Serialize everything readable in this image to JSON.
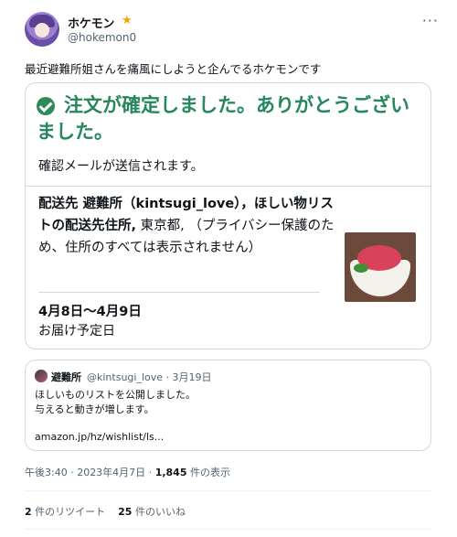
{
  "user": {
    "name": "ホケモン",
    "handle": "@hokemon0",
    "badge_icon": "star-badge-icon"
  },
  "tweet": {
    "text": "最近避難所姐さんを痛風にしようと企んでるホケモンです"
  },
  "order": {
    "title": "注文が確定しました。ありがとうございました。",
    "subtitle": "確認メールが送信されます。",
    "ship_label": "配送先 避難所（kintsugi_love），ほしい物リストの配送先住所,",
    "ship_rest": " 東京都, （プライバシー保護のため、住所のすべては表示されません）",
    "delivery_dates": "4月8日〜4月9日",
    "delivery_label": "お届け予定日"
  },
  "quote": {
    "name": "避難所",
    "handle": "@kintsugi_love",
    "date": "3月19日",
    "line1": "ほしいものリストを公開しました。",
    "line2": "与えると動きが増します。",
    "link": "amazon.jp/hz/wishlist/ls..."
  },
  "meta": {
    "time": "午後3:40 · 2023年4月7日 · ",
    "views": "1,845",
    "views_label": " 件の表示"
  },
  "stats": {
    "retweets": "2",
    "retweets_label": " 件のリツイート",
    "likes": "25",
    "likes_label": " 件のいいね"
  },
  "colors": {
    "accent_green": "#26865c",
    "badge_gold": "#f4a300"
  }
}
